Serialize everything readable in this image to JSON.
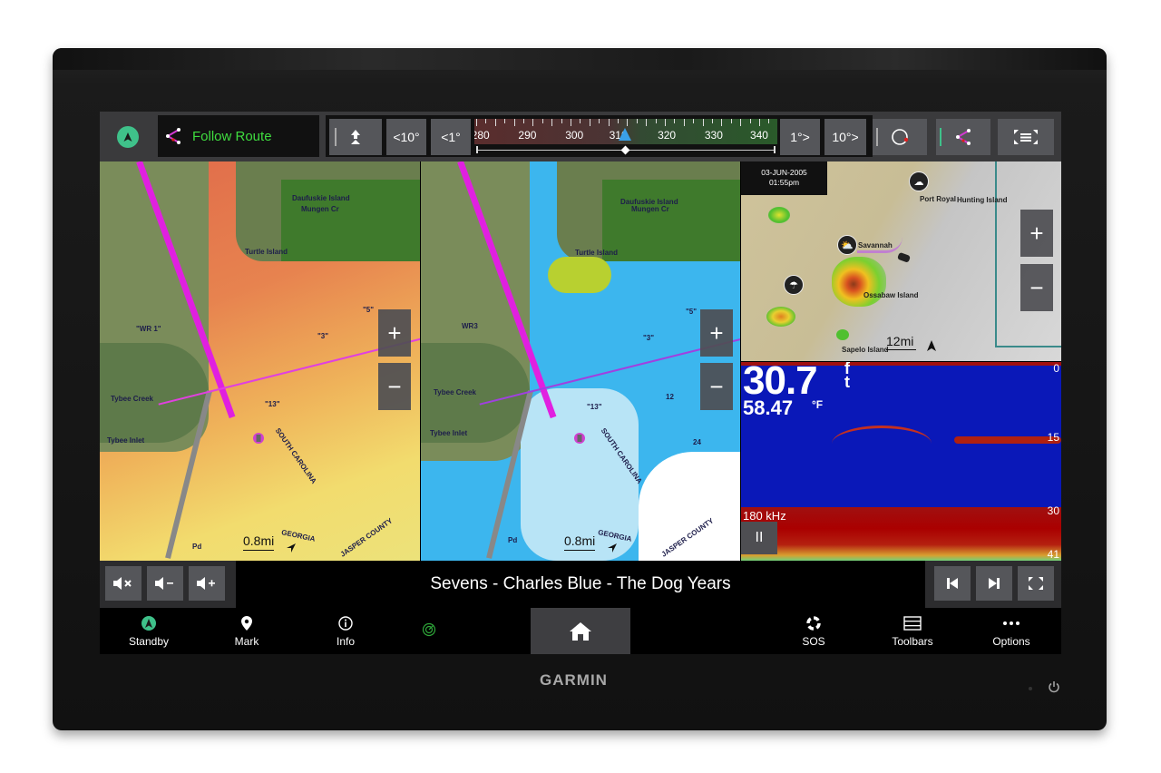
{
  "topbar": {
    "route_label": "Follow Route",
    "steer_buttons": [
      "<10°",
      "<1°",
      "1°>",
      "10°>"
    ],
    "heading_scale": [
      "280",
      "290",
      "300",
      "310",
      "320",
      "330",
      "340"
    ],
    "heading_value": "314"
  },
  "charts": {
    "left": {
      "scale": "0.8mi",
      "labels": [
        "Daufuskie Island",
        "Mungen Cr",
        "Turtle Island",
        "Tybee Creek",
        "Tybee Inlet",
        "SOUTH CAROLINA",
        "GEORGIA",
        "JASPER COUNTY",
        "\"WR 1\"",
        "\"5\"",
        "\"3\"",
        "\"13\"",
        "Pd"
      ]
    },
    "middle": {
      "scale": "0.8mi",
      "labels": [
        "Daufuskie Island",
        "Mungen Cr",
        "Turtle Island",
        "Tybee Creek",
        "Tybee Inlet",
        "SOUTH CAROLINA",
        "GEORGIA",
        "JASPER COUNTY",
        "WR3",
        "\"5\"",
        "\"3\"",
        "\"13\"",
        "12",
        "24",
        "Pd"
      ]
    }
  },
  "weather": {
    "date": "03-JUN-2005",
    "time": "01:55pm",
    "scale": "12mi",
    "labels": [
      "Port Royal",
      "Hunting Island",
      "Savannah",
      "Ossabaw Island",
      "Sapelo Island"
    ]
  },
  "sonar": {
    "depth": "30.7",
    "depth_unit": "ft",
    "temperature": "58.47",
    "temp_unit": "°F",
    "frequency": "180 kHz",
    "scale_marks": [
      "0",
      "15",
      "30",
      "41"
    ],
    "pause_label": "II"
  },
  "media": {
    "track": "Sevens - Charles Blue - The Dog Years"
  },
  "bottom_nav": {
    "standby": "Standby",
    "mark": "Mark",
    "info": "Info",
    "sos": "SOS",
    "toolbars": "Toolbars",
    "options": "Options"
  },
  "device": {
    "brand": "GARMIN"
  },
  "colors": {
    "accent_green": "#3fc18a",
    "route_magenta": "#e020e0",
    "follow_route_text": "#3fdc3f"
  }
}
